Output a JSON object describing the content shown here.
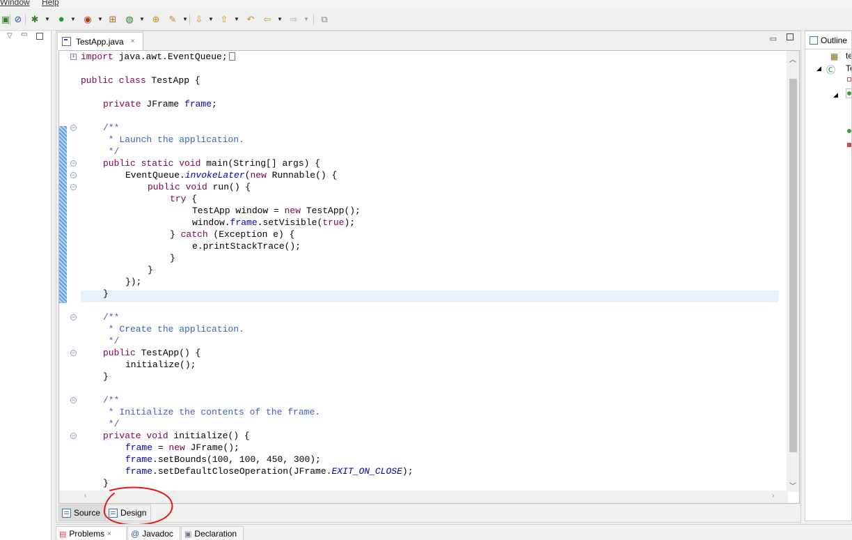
{
  "menu": {
    "items": [
      "Window",
      "Help"
    ]
  },
  "editor": {
    "tab_label": "TestApp.java",
    "close_glyph": "×",
    "code_lines": [
      {
        "indent": 0,
        "parts": [
          [
            "kw",
            "import"
          ],
          [
            "",
            " java.awt.EventQueue;"
          ]
        ],
        "box": true
      },
      {
        "indent": 0,
        "parts": []
      },
      {
        "indent": 0,
        "parts": [
          [
            "kw",
            "public class"
          ],
          [
            "",
            " TestApp {"
          ]
        ]
      },
      {
        "indent": 0,
        "parts": []
      },
      {
        "indent": 1,
        "parts": [
          [
            "kw",
            "private"
          ],
          [
            "",
            " JFrame "
          ],
          [
            "fld",
            "frame"
          ],
          [
            "",
            ";"
          ]
        ]
      },
      {
        "indent": 0,
        "parts": []
      },
      {
        "indent": 1,
        "parts": [
          [
            "cm",
            "/**"
          ]
        ]
      },
      {
        "indent": 1,
        "parts": [
          [
            "cm",
            " * Launch the application."
          ]
        ]
      },
      {
        "indent": 1,
        "parts": [
          [
            "cm",
            " */"
          ]
        ]
      },
      {
        "indent": 1,
        "parts": [
          [
            "kw",
            "public static void"
          ],
          [
            "",
            " main(String[] args) {"
          ]
        ]
      },
      {
        "indent": 2,
        "parts": [
          [
            "",
            "EventQueue."
          ],
          [
            "sm",
            "invokeLater"
          ],
          [
            "",
            "("
          ],
          [
            "kw",
            "new"
          ],
          [
            "",
            " Runnable() {"
          ]
        ]
      },
      {
        "indent": 3,
        "parts": [
          [
            "kw",
            "public void"
          ],
          [
            "",
            " run() {"
          ]
        ]
      },
      {
        "indent": 4,
        "parts": [
          [
            "kw",
            "try"
          ],
          [
            "",
            " {"
          ]
        ]
      },
      {
        "indent": 5,
        "parts": [
          [
            "",
            "TestApp window = "
          ],
          [
            "kw",
            "new"
          ],
          [
            "",
            " TestApp();"
          ]
        ]
      },
      {
        "indent": 5,
        "parts": [
          [
            "",
            "window."
          ],
          [
            "fld",
            "frame"
          ],
          [
            "",
            ".setVisible("
          ],
          [
            "kw",
            "true"
          ],
          [
            "",
            ");"
          ]
        ]
      },
      {
        "indent": 4,
        "parts": [
          [
            "",
            "} "
          ],
          [
            "kw",
            "catch"
          ],
          [
            "",
            " (Exception e) {"
          ]
        ]
      },
      {
        "indent": 5,
        "parts": [
          [
            "",
            "e.printStackTrace();"
          ]
        ]
      },
      {
        "indent": 4,
        "parts": [
          [
            "",
            "}"
          ]
        ]
      },
      {
        "indent": 3,
        "parts": [
          [
            "",
            "}"
          ]
        ]
      },
      {
        "indent": 2,
        "parts": [
          [
            "",
            "});"
          ]
        ]
      },
      {
        "indent": 1,
        "parts": [
          [
            "",
            "}"
          ]
        ]
      },
      {
        "indent": 0,
        "parts": []
      },
      {
        "indent": 1,
        "parts": [
          [
            "cm",
            "/**"
          ]
        ]
      },
      {
        "indent": 1,
        "parts": [
          [
            "cm",
            " * Create the application."
          ]
        ]
      },
      {
        "indent": 1,
        "parts": [
          [
            "cm",
            " */"
          ]
        ]
      },
      {
        "indent": 1,
        "parts": [
          [
            "kw",
            "public"
          ],
          [
            "",
            " TestApp() {"
          ]
        ]
      },
      {
        "indent": 2,
        "parts": [
          [
            "",
            "initialize();"
          ]
        ]
      },
      {
        "indent": 1,
        "parts": [
          [
            "",
            "}"
          ]
        ]
      },
      {
        "indent": 0,
        "parts": []
      },
      {
        "indent": 1,
        "parts": [
          [
            "cm",
            "/**"
          ]
        ]
      },
      {
        "indent": 1,
        "parts": [
          [
            "cm",
            " * Initialize the contents of the frame."
          ]
        ]
      },
      {
        "indent": 1,
        "parts": [
          [
            "cm",
            " */"
          ]
        ]
      },
      {
        "indent": 1,
        "parts": [
          [
            "kw",
            "private void"
          ],
          [
            "",
            " initialize() {"
          ]
        ]
      },
      {
        "indent": 2,
        "parts": [
          [
            "fld",
            "frame"
          ],
          [
            "",
            " = "
          ],
          [
            "kw",
            "new"
          ],
          [
            "",
            " JFrame();"
          ]
        ]
      },
      {
        "indent": 2,
        "parts": [
          [
            "fld",
            "frame"
          ],
          [
            "",
            ".setBounds(100, 100, 450, 300);"
          ]
        ]
      },
      {
        "indent": 2,
        "parts": [
          [
            "fld",
            "frame"
          ],
          [
            "",
            ".setDefaultCloseOperation(JFrame."
          ],
          [
            "sm",
            "EXIT_ON_CLOSE"
          ],
          [
            "",
            ");"
          ]
        ]
      },
      {
        "indent": 1,
        "parts": [
          [
            "",
            "}"
          ]
        ]
      }
    ],
    "source_tab": "Source",
    "design_tab": "Design"
  },
  "outline": {
    "tab_label": "Outline",
    "node_1": "te",
    "node_2": "Te"
  },
  "bottom_tabs": {
    "problems": "Problems",
    "javadoc": "Javadoc",
    "declaration": "Declaration",
    "close_glyph": "×"
  },
  "colors": {
    "keyword": "#7f0055",
    "field": "#0000c0",
    "comment": "#3f5fbf",
    "annotation": "#e0191c"
  }
}
